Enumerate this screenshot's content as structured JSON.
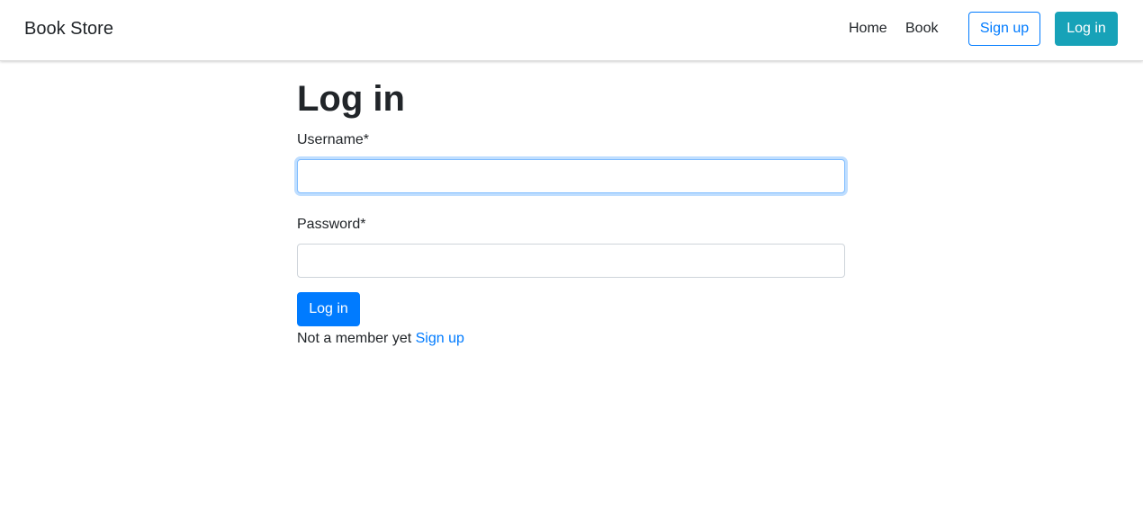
{
  "navbar": {
    "brand": "Book Store",
    "links": [
      "Home",
      "Book"
    ],
    "signup_label": "Sign up",
    "login_label": "Log in"
  },
  "form": {
    "title": "Log in",
    "username_label": "Username*",
    "username_value": "",
    "password_label": "Password*",
    "password_value": "",
    "submit_label": "Log in",
    "footer_text": "Not a member yet",
    "footer_link": "Sign up"
  },
  "colors": {
    "primary": "#007bff",
    "info": "#17a2b8",
    "text": "#212529",
    "focus_border": "#80bdff"
  }
}
